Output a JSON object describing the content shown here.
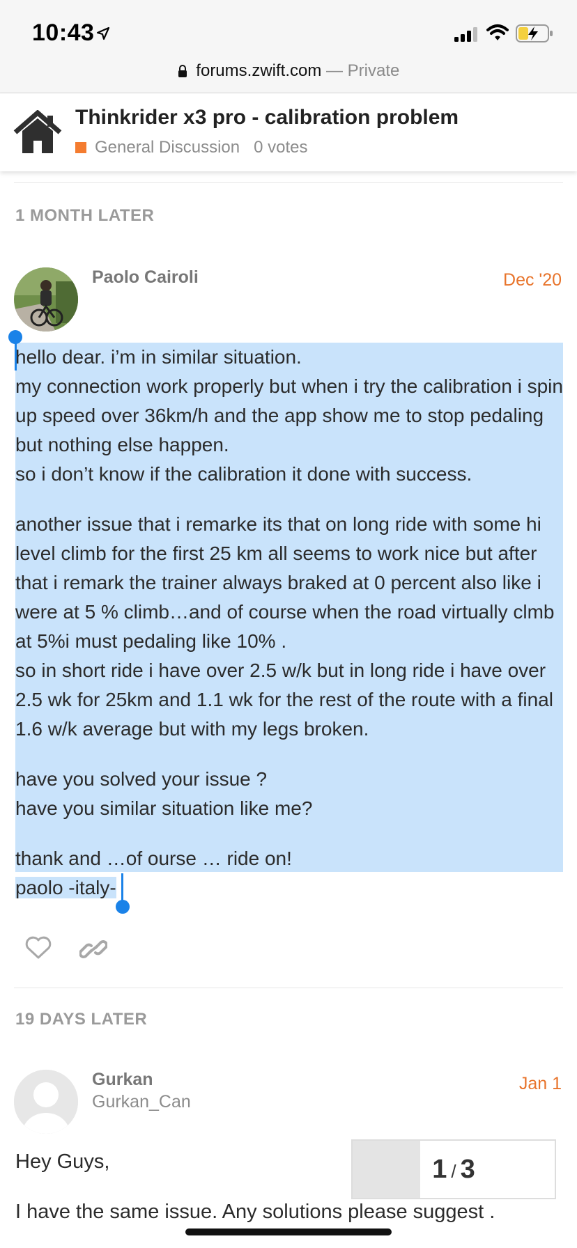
{
  "status_bar": {
    "time": "10:43"
  },
  "browser": {
    "domain": "forums.zwift.com",
    "mode": "— Private"
  },
  "topic": {
    "title": "Thinkrider x3 pro - calibration problem",
    "category": "General Discussion",
    "votes": "0 votes",
    "category_color": "#f47c30"
  },
  "posts": [
    {
      "time_gap": "1 MONTH LATER",
      "username": "Paolo Cairoli",
      "date": "Dec '20",
      "paragraphs": [
        [
          "hello dear. i’m in similar situation.",
          "my connection work properly but when i try the calibration i spin up speed over 36km/h and the app show me to stop pedaling but nothing else happen.",
          "so i don’t know if the calibration it done with success."
        ],
        [
          "another issue that i remarke its that on long ride with some hi level climb for the first 25 km all seems to work nice but after that i remark the trainer always braked at 0 percent also like i were at 5 % climb…and of course when the road virtually clmb at 5%i must pedaling like 10% .",
          "so in short ride i have over 2.5 w/k but in long ride i have over 2.5 wk for 25km and 1.1 wk for the rest of the route with a final 1.6 w/k average but with my legs broken."
        ],
        [
          "have you solved your issue ?",
          "have you similar situation like me?"
        ],
        [
          "thank and …of ourse … ride on!",
          "paolo -italy-"
        ]
      ]
    },
    {
      "time_gap": "19 DAYS LATER",
      "username": "Gurkan",
      "handle": "Gurkan_Can",
      "date": "Jan 1",
      "lines": [
        "Hey Guys,",
        "I have the same issue. Any solutions please suggest ."
      ]
    }
  ],
  "progress": {
    "current": "1",
    "separator": "/",
    "total": "3",
    "fraction": 0.333
  },
  "colors": {
    "accent": "#e8742b",
    "selection": "#c9e3fb",
    "handle": "#1a82e8"
  }
}
